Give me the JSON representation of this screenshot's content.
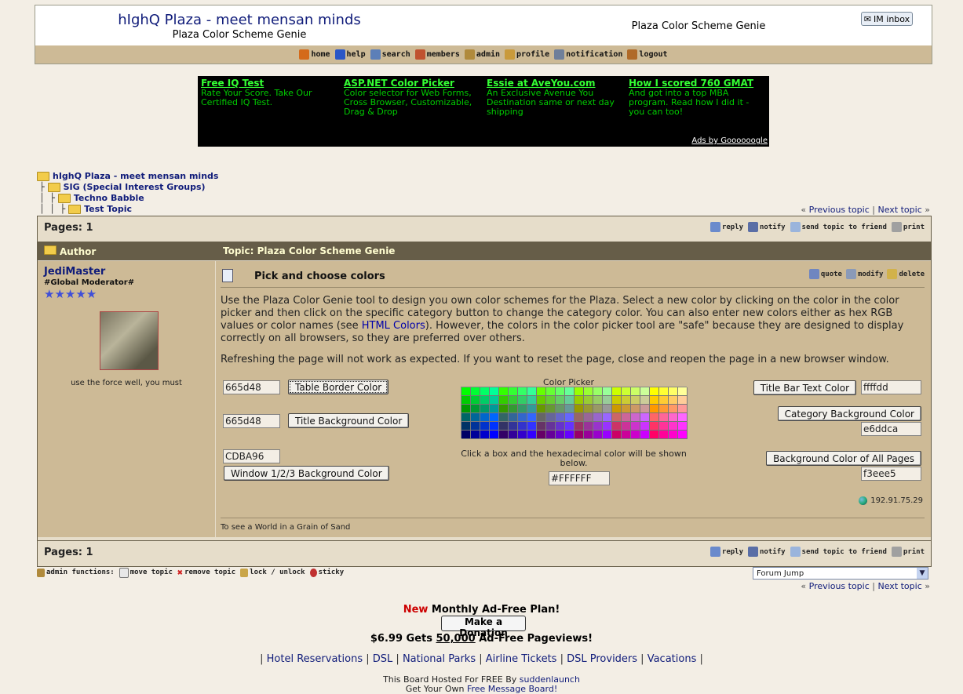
{
  "header": {
    "title": "hIghQ Plaza - meet mensan minds",
    "subtitle": "Plaza Color Scheme Genie",
    "page_heading": "Plaza Color Scheme Genie",
    "im_inbox": "IM inbox"
  },
  "nav": [
    {
      "label": "home",
      "icon": "home-icon",
      "color": "#d46a1a"
    },
    {
      "label": "help",
      "icon": "help-icon",
      "color": "#2a56c6"
    },
    {
      "label": "search",
      "icon": "search-icon",
      "color": "#5c7fb8"
    },
    {
      "label": "members",
      "icon": "members-icon",
      "color": "#c0522f"
    },
    {
      "label": "admin",
      "icon": "admin-icon",
      "color": "#b08a3c"
    },
    {
      "label": "profile",
      "icon": "profile-icon",
      "color": "#c99a3b"
    },
    {
      "label": "notification",
      "icon": "notification-icon",
      "color": "#6f7f9a"
    },
    {
      "label": "logout",
      "icon": "logout-icon",
      "color": "#b06a28"
    }
  ],
  "ads": [
    {
      "title": "Free IQ Test",
      "text": "Rate Your Score. Take Our Certified IQ Test."
    },
    {
      "title": "ASP.NET Color Picker",
      "text": "Color selector for Web Forms, Cross Browser, Customizable, Drag & Drop"
    },
    {
      "title": "Essie at AveYou.com",
      "text": "An Exclusive Avenue You Destination same or next day shipping"
    },
    {
      "title": "How I scored 760 GMAT",
      "text": "And got into a top MBA program. Read how I did it - you can too!"
    }
  ],
  "ads_by": "Ads by Goooooogle",
  "breadcrumb": [
    "hIghQ Plaza - meet mensan minds",
    "SIG (Special Interest Groups)",
    "Techno Babble",
    "Test Topic"
  ],
  "topic_nav": {
    "prev": "Previous topic",
    "next": "Next topic",
    "sep": "|",
    "left": "«",
    "right": "»"
  },
  "pages_label": "Pages: 1",
  "topic_buttons": [
    "reply",
    "notify",
    "send topic to friend",
    "print"
  ],
  "title_bar": {
    "author": "Author",
    "topic": "Topic: Plaza Color Scheme Genie"
  },
  "author": {
    "name": "JediMaster",
    "rank": "#Global Moderator#",
    "stars": "★★★★★",
    "signature": "use the force well, you must"
  },
  "post": {
    "subject": "Pick and choose colors",
    "actions": [
      "quote",
      "modify",
      "delete"
    ],
    "para1_a": "Use the Plaza Color Genie tool to design you own color schemes for the Plaza. Select a new color by clicking on the color in the color picker and then click on the specific category button to change the category color. You can also enter new colors either as hex RGB values or color names (see ",
    "para1_link": "HTML Colors",
    "para1_b": "). However, the colors in the color picker tool are \"safe\" because they are designed to display correctly on all browsers, so they are preferred over others.",
    "para2": "Refreshing the page will not work as expected. If you want to reset the page, close and reopen the page in a new browser window.",
    "ip": "192.91.75.29",
    "sig_line": "To see a World in a Grain of Sand"
  },
  "genie": {
    "table_border_value": "665d48",
    "table_border_label": "Table Border Color",
    "title_bg_value": "665d48",
    "title_bg_label": "Title Background Color",
    "window_bg_value": "CDBA96",
    "window_bg_label": "Window 1/2/3 Background Color",
    "picker_label": "Color Picker",
    "picker_instructions": "Click a box and the hexadecimal color will be shown below.",
    "picker_value": "#FFFFFF",
    "title_text_label": "Title Bar Text Color",
    "title_text_value": "ffffdd",
    "category_bg_label": "Category Background Color",
    "category_bg_value": "e6ddca",
    "page_bg_label": "Background Color of All Pages",
    "page_bg_value": "f3eee5"
  },
  "admin": {
    "label": "admin functions:",
    "items": [
      "move topic",
      "remove topic",
      "lock / unlock",
      "sticky"
    ]
  },
  "forum_jump": "Forum Jump",
  "footer": {
    "new": "New",
    "plan": " Monthly Ad-Free Plan!",
    "donate": "Make a Donation",
    "price_a": "$6.99 Gets ",
    "price_b": "50,000",
    "price_c": " Ad-Free Pageviews!",
    "links": [
      "Hotel Reservations",
      "DSL",
      "National Parks",
      "Airline Tickets",
      "DSL Providers",
      "Vacations"
    ],
    "hosted_a": "This Board Hosted For FREE By ",
    "hosted_link": "suddenlaunch",
    "get_own": "Get Your Own ",
    "get_own_link": "Free Message Board!"
  },
  "colors": {
    "page_bg": "#f3eee5",
    "table_border": "#665d48",
    "window_bg": "#cdba96",
    "category_bg": "#e6ddca",
    "title_text": "#fffdd0",
    "new_red": "#cc0000"
  }
}
